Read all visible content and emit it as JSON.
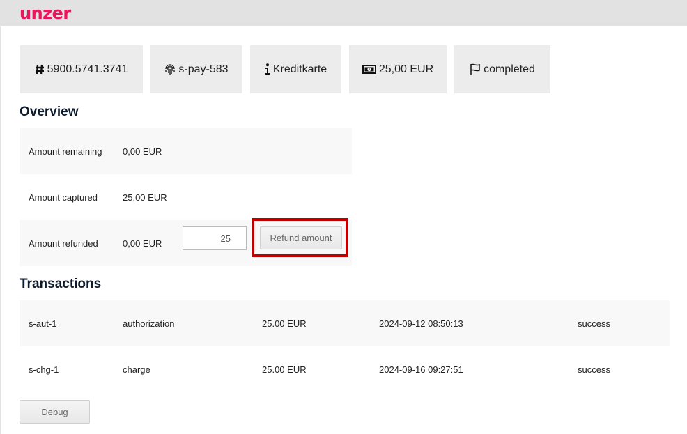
{
  "header": {
    "logo": "unzer",
    "brand_color": "#e8175d"
  },
  "tiles": [
    {
      "icon": "hash-icon",
      "label": "5900.5741.3741"
    },
    {
      "icon": "fingerprint-icon",
      "label": "s-pay-583"
    },
    {
      "icon": "info-icon",
      "label": "Kreditkarte"
    },
    {
      "icon": "money-bill-icon",
      "label": "25,00 EUR"
    },
    {
      "icon": "flag-icon",
      "label": "completed"
    }
  ],
  "overview": {
    "title": "Overview",
    "rows": [
      {
        "label": "Amount remaining",
        "value": "0,00 EUR"
      },
      {
        "label": "Amount captured",
        "value": "25,00 EUR"
      },
      {
        "label": "Amount refunded",
        "value": "0,00 EUR"
      }
    ],
    "refund_input_value": "25",
    "refund_button": "Refund amount",
    "highlight_color": "#c00000"
  },
  "transactions": {
    "title": "Transactions",
    "rows": [
      {
        "id": "s-aut-1",
        "type": "authorization",
        "amount": "25.00 EUR",
        "date": "2024-09-12 08:50:13",
        "status": "success"
      },
      {
        "id": "s-chg-1",
        "type": "charge",
        "amount": "25.00 EUR",
        "date": "2024-09-16 09:27:51",
        "status": "success"
      }
    ]
  },
  "debug_button": "Debug"
}
